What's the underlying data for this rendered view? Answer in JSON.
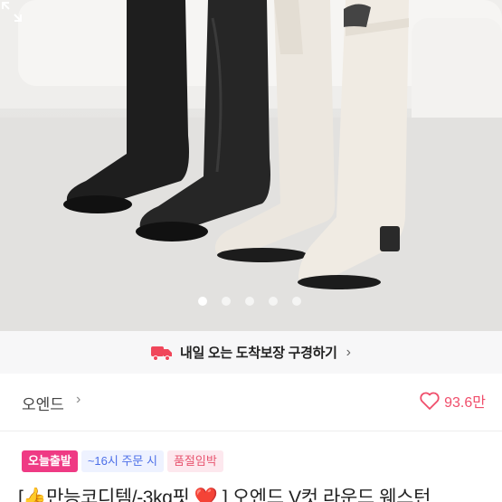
{
  "photo": {
    "slide_count": 5,
    "active_slide_index": 0,
    "expand_icon": "expand-icon"
  },
  "delivery": {
    "icon": "truck-icon",
    "text": "내일 오는 도착보장 구경하기",
    "chevron": "›"
  },
  "seller": {
    "name": "오엔드",
    "chevron": "›",
    "like_icon": "heart-outline-icon",
    "like_count": "93.6만"
  },
  "badges": {
    "today": "오늘출발",
    "order_time": "~16시 주문 시",
    "low_stock": "품절임박"
  },
  "title": {
    "text": "[👍만능코디템/-3kg핏 ❤️ ] 오엔드 V컷 라운드 웨스턴"
  },
  "colors": {
    "accent_pink": "#ef3a84",
    "like_pink": "#f04e6b",
    "badge_blue": "#4c6fe8"
  }
}
